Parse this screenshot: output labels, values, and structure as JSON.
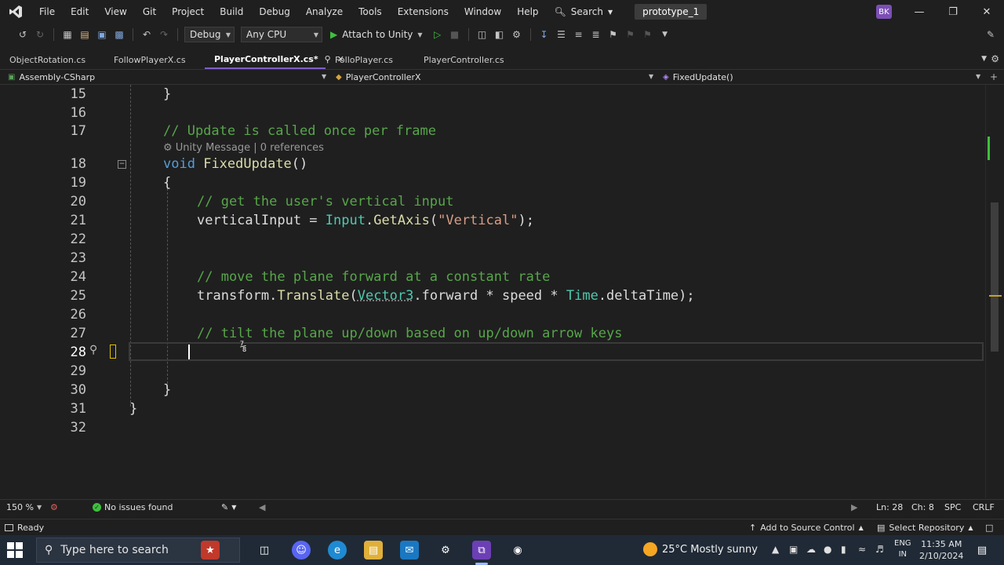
{
  "menu": {
    "items": [
      "File",
      "Edit",
      "View",
      "Git",
      "Project",
      "Build",
      "Debug",
      "Analyze",
      "Tools",
      "Extensions",
      "Window",
      "Help"
    ],
    "search_label": "Search",
    "solution": "prototype_1",
    "avatar_initials": "BK"
  },
  "toolbar": {
    "config": "Debug",
    "platform": "Any CPU",
    "attach_label": "Attach to Unity"
  },
  "tabs": [
    {
      "label": "ObjectRotation.cs"
    },
    {
      "label": "FollowPlayerX.cs"
    },
    {
      "label": "PlayerControllerX.cs*"
    },
    {
      "label": "FolloPlayer.cs"
    },
    {
      "label": "PlayerController.cs"
    }
  ],
  "nav": {
    "project": "Assembly-CSharp",
    "class": "PlayerControllerX",
    "member": "FixedUpdate()"
  },
  "editor": {
    "line_numbers": [
      "15",
      "16",
      "17",
      "18",
      "19",
      "20",
      "21",
      "22",
      "23",
      "24",
      "25",
      "26",
      "27",
      "28",
      "29",
      "30",
      "31",
      "32"
    ],
    "codelens": "Unity Message | 0 references",
    "code": {
      "l15": "}",
      "l17": "// Update is called once per frame",
      "l18_kw": "void",
      "l18_fn": "FixedUpdate",
      "l18_rest": "()",
      "l19": "{",
      "l20": "// get the user's vertical input",
      "l21_a": "verticalInput = ",
      "l21_ty": "Input",
      "l21_b": ".",
      "l21_fn": "GetAxis",
      "l21_c": "(",
      "l21_st": "\"Vertical\"",
      "l21_d": ");",
      "l24": "// move the plane forward at a constant rate",
      "l25_a": "transform.",
      "l25_fn": "Translate",
      "l25_b": "(",
      "l25_ty1": "Vector3",
      "l25_c": ".forward * speed * ",
      "l25_ty2": "Time",
      "l25_d": ".deltaTime);",
      "l27": "// tilt the plane up/down based on up/down arrow keys",
      "l30": "}",
      "l31": "}"
    }
  },
  "editor_status": {
    "zoom": "150 %",
    "issues": "No issues found",
    "position_ln": "Ln: 28",
    "position_ch": "Ch: 8",
    "whitespace": "SPC",
    "line_endings": "CRLF"
  },
  "status": {
    "ready": "Ready",
    "source_control": "Add to Source Control",
    "repository": "Select Repository"
  },
  "taskbar": {
    "search_placeholder": "Type here to search",
    "weather": "25°C  Mostly sunny",
    "lang_1": "ENG",
    "lang_2": "IN",
    "time": "11:35 AM",
    "date": "2/10/2024"
  },
  "colors": {
    "accent": "#7f5ec9",
    "keyword": "#569cd6",
    "comment": "#57a64a",
    "type": "#4ec9b0",
    "string": "#d69d85"
  }
}
